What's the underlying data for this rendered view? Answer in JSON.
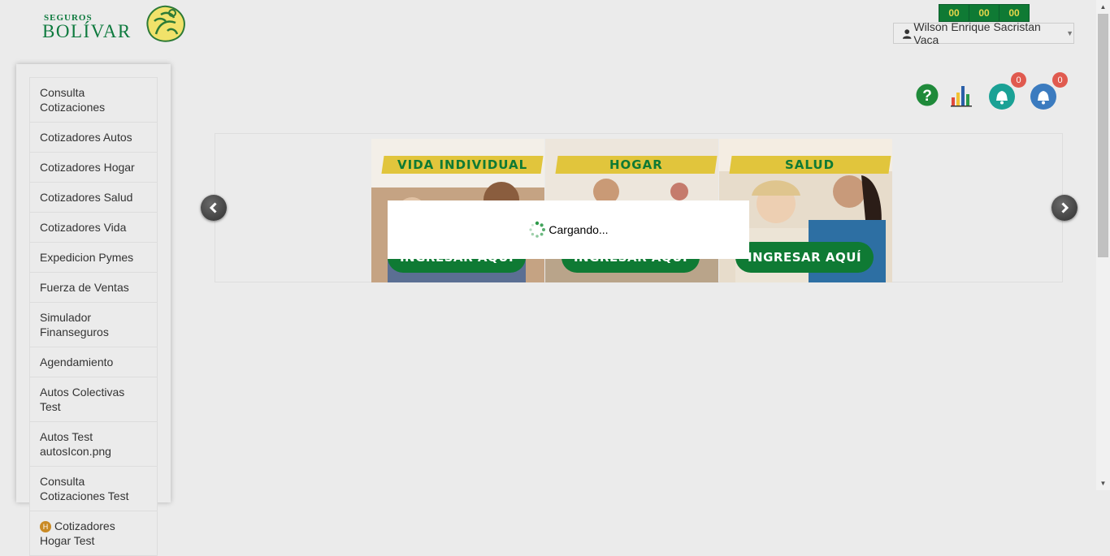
{
  "brand": {
    "small": "SEGUROS",
    "big": "BOLÍVAR"
  },
  "timer": {
    "hours": "00",
    "minutes": "00",
    "seconds": "00"
  },
  "user": {
    "name": "Wilson Enrique Sacristan Vaca"
  },
  "toolbar": {
    "help_icon": "question-circle-icon",
    "stats_icon": "bar-chart-icon",
    "notifications_badge": "0",
    "alerts_badge": "0"
  },
  "sidebar": {
    "items": [
      {
        "label": "Consulta Cotizaciones"
      },
      {
        "label": "Cotizadores Autos"
      },
      {
        "label": "Cotizadores Hogar"
      },
      {
        "label": "Cotizadores Salud"
      },
      {
        "label": "Cotizadores Vida"
      },
      {
        "label": "Expedicion Pymes"
      },
      {
        "label": "Fuerza de Ventas"
      },
      {
        "label": "Simulador Finanseguros"
      },
      {
        "label": "Agendamiento"
      },
      {
        "label": "Autos Colectivas Test"
      },
      {
        "label": "Autos Test autosIcon.png"
      },
      {
        "label": "Consulta Cotizaciones Test"
      },
      {
        "label": "Cotizadores Hogar Test",
        "icon_letter": "H"
      }
    ]
  },
  "carousel": {
    "cards": [
      {
        "title": "VIDA INDIVIDUAL",
        "cta": "INGRESAR AQUÍ"
      },
      {
        "title": "HOGAR",
        "cta": "INGRESAR AQUÍ"
      },
      {
        "title": "SALUD",
        "cta": "INGRESAR AQUÍ"
      }
    ]
  },
  "loading": {
    "text": "Cargando..."
  },
  "colors": {
    "brand_green": "#0f7a34",
    "brand_yellow": "#e1c53c",
    "badge_red": "#e05a4f"
  }
}
